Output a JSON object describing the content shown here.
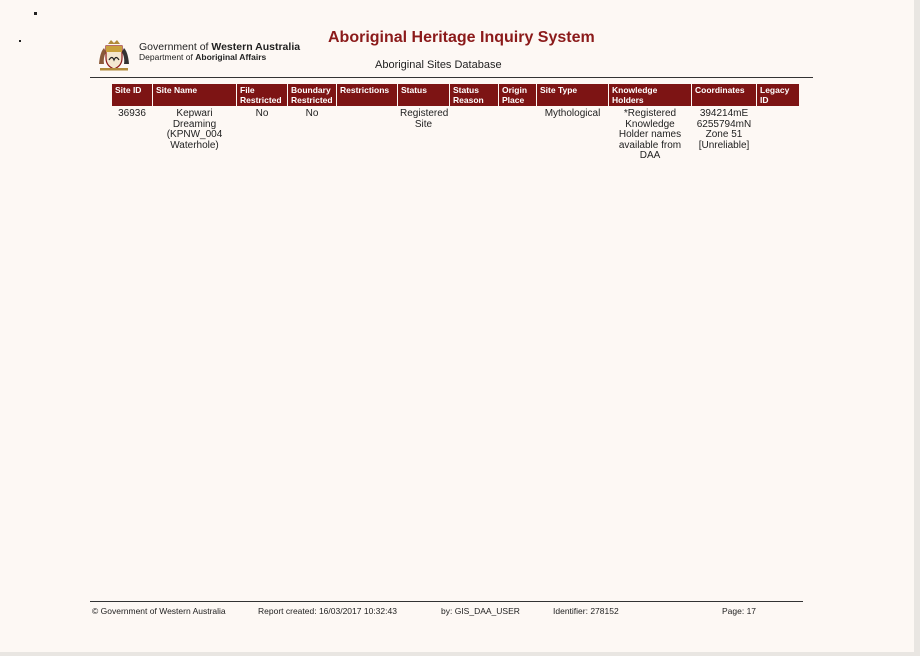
{
  "header": {
    "gov_prefix": "Government of ",
    "gov_bold": "Western Australia",
    "dept_prefix": "Department of ",
    "dept_bold": "Aboriginal Affairs",
    "system_title": "Aboriginal Heritage Inquiry System",
    "database_name": "Aboriginal Sites Database"
  },
  "table": {
    "columns": [
      "Site ID",
      "Site Name",
      "File Restricted",
      "Boundary Restricted",
      "Restrictions",
      "Status",
      "Status Reason",
      "Origin Place ID",
      "Site Type",
      "Knowledge Holders",
      "Coordinates",
      "Legacy ID"
    ],
    "rows": [
      {
        "site_id": "36936",
        "site_name": "Kepwari Dreaming (KPNW_004 Waterhole)",
        "file_restricted": "No",
        "boundary_restricted": "No",
        "restrictions": "",
        "status": "Registered Site",
        "status_reason": "",
        "origin_place_id": "",
        "site_type": "Mythological",
        "knowledge_holders": "*Registered Knowledge Holder names available from DAA",
        "coordinates": "394214mE 6255794mN Zone 51 [Unreliable]",
        "legacy_id": ""
      }
    ]
  },
  "footer": {
    "copyright": "© Government of Western Australia",
    "report_created": "Report created: 16/03/2017 10:32:43",
    "by": "by:  GIS_DAA_USER",
    "identifier": "Identifier: 278152",
    "page": "Page: 17"
  },
  "colors": {
    "header_bg": "#7d1414",
    "title": "#8b1a1a"
  },
  "icons": {
    "logo": "wa-coat-of-arms-crest"
  }
}
